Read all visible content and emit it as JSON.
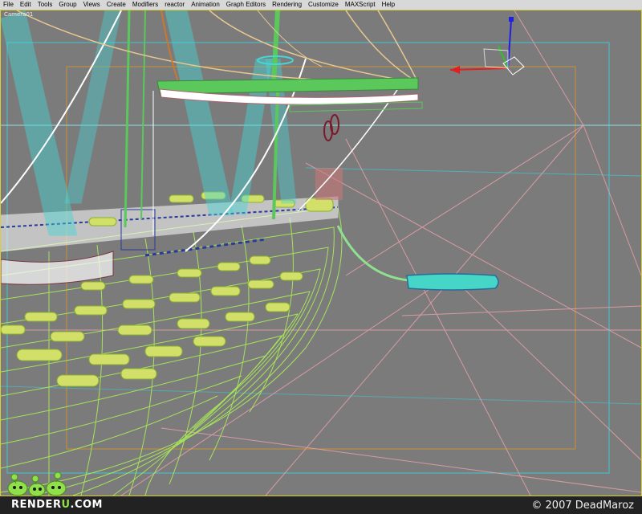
{
  "menubar": {
    "items": [
      {
        "label": "File"
      },
      {
        "label": "Edit"
      },
      {
        "label": "Tools"
      },
      {
        "label": "Group"
      },
      {
        "label": "Views"
      },
      {
        "label": "Create"
      },
      {
        "label": "Modifiers"
      },
      {
        "label": "reactor"
      },
      {
        "label": "Animation"
      },
      {
        "label": "Graph Editors"
      },
      {
        "label": "Rendering"
      },
      {
        "label": "Customize"
      },
      {
        "label": "MAXScript"
      },
      {
        "label": "Help"
      }
    ]
  },
  "viewport": {
    "label": "Camera01",
    "background": "#7b7b7b",
    "border_color": "#d6cf3a",
    "hull_color": "#a6e35a",
    "rigging_color": "#45d6d6",
    "cannon_color": "#d2e06a"
  },
  "gizmo": {
    "x_color": "#e02020",
    "y_color": "#2020e0",
    "z_color": "#30c030"
  },
  "footer": {
    "brand_main": "RENDER",
    "brand_accent": "U",
    "brand_suffix": ".COM",
    "copyright": "© 2007 DeadMaroz"
  }
}
